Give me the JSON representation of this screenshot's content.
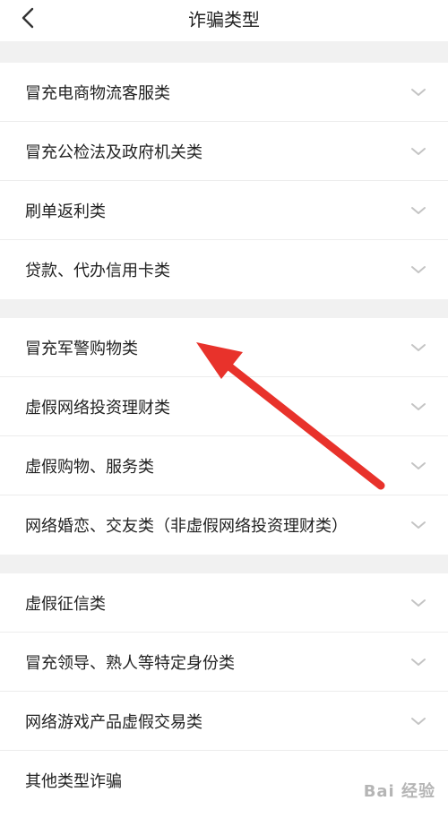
{
  "header": {
    "title": "诈骗类型",
    "back_icon": "chevron-left-icon"
  },
  "sections": [
    {
      "items": [
        {
          "label": "冒充电商物流客服类"
        },
        {
          "label": "冒充公检法及政府机关类"
        },
        {
          "label": "刷单返利类"
        },
        {
          "label": "贷款、代办信用卡类"
        }
      ]
    },
    {
      "items": [
        {
          "label": "冒充军警购物类"
        },
        {
          "label": "虚假网络投资理财类"
        },
        {
          "label": "虚假购物、服务类"
        },
        {
          "label": "网络婚恋、交友类（非虚假网络投资理财类）"
        }
      ]
    },
    {
      "items": [
        {
          "label": "虚假征信类"
        },
        {
          "label": "冒充领导、熟人等特定身份类"
        },
        {
          "label": "网络游戏产品虚假交易类"
        },
        {
          "label": "其他类型诈骗"
        }
      ]
    }
  ],
  "annotation": {
    "color": "#e8322b"
  },
  "watermark": {
    "text": "Bai 经验"
  }
}
